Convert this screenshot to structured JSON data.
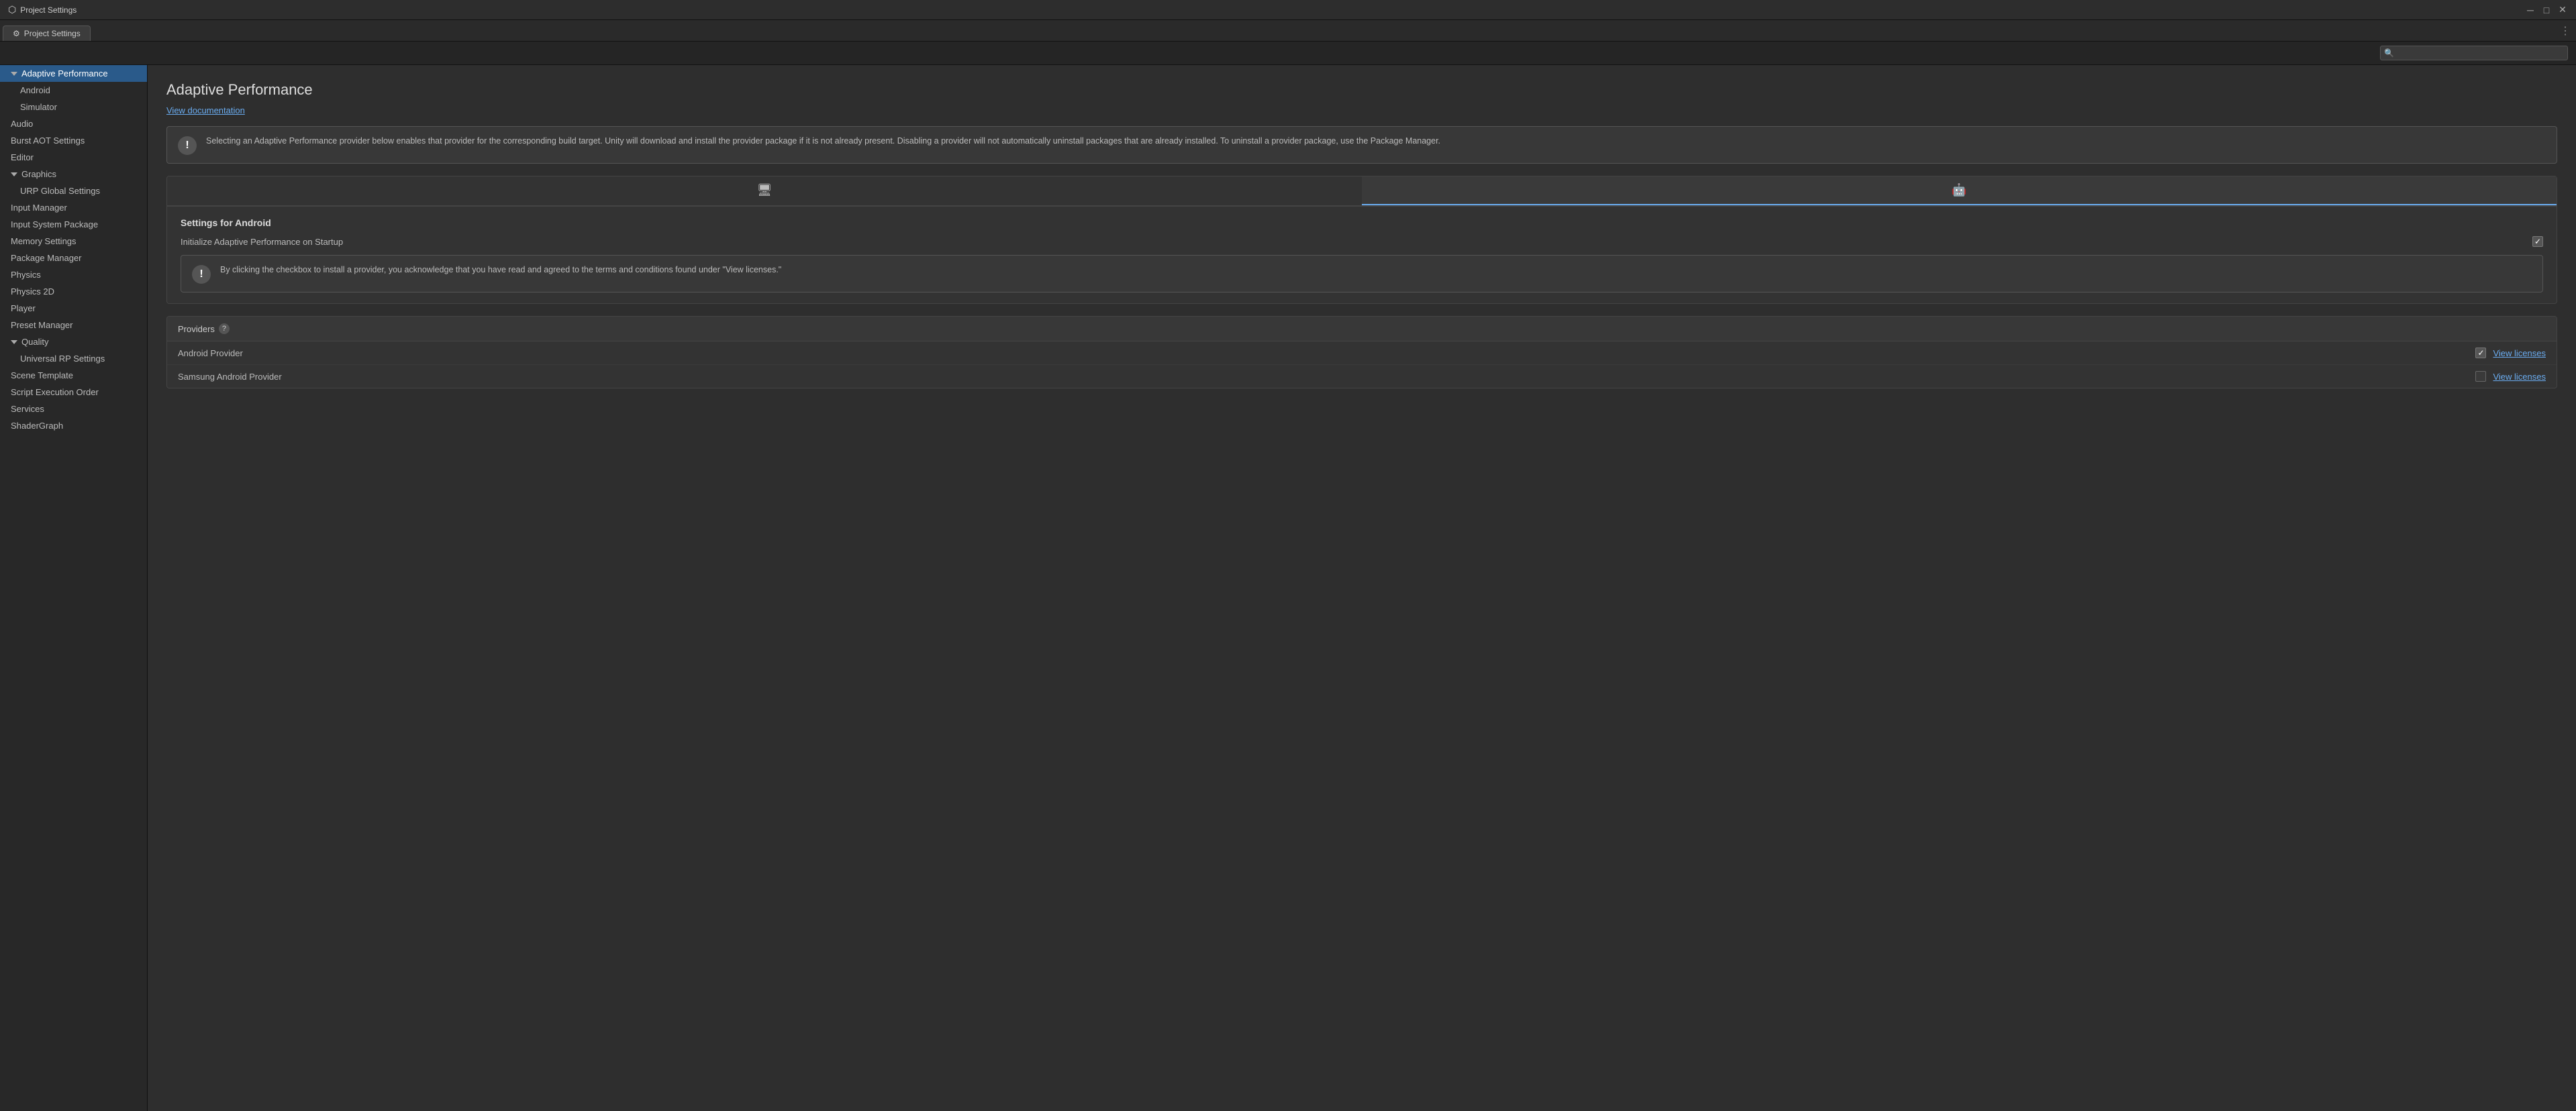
{
  "window": {
    "title": "Project Settings",
    "tab_label": "Project Settings",
    "controls": {
      "minimize": "─",
      "maximize": "□",
      "close": "✕"
    }
  },
  "search": {
    "placeholder": ""
  },
  "sidebar": {
    "items": [
      {
        "id": "adaptive-performance",
        "label": "Adaptive Performance",
        "level": 0,
        "active": true,
        "has_triangle": true
      },
      {
        "id": "android",
        "label": "Android",
        "level": 1
      },
      {
        "id": "simulator",
        "label": "Simulator",
        "level": 1
      },
      {
        "id": "audio",
        "label": "Audio",
        "level": 0
      },
      {
        "id": "burst-aot",
        "label": "Burst AOT Settings",
        "level": 0
      },
      {
        "id": "editor",
        "label": "Editor",
        "level": 0
      },
      {
        "id": "graphics",
        "label": "Graphics",
        "level": 0,
        "has_triangle": true
      },
      {
        "id": "urp-global",
        "label": "URP Global Settings",
        "level": 1
      },
      {
        "id": "input-manager",
        "label": "Input Manager",
        "level": 0
      },
      {
        "id": "input-system",
        "label": "Input System Package",
        "level": 0
      },
      {
        "id": "memory-settings",
        "label": "Memory Settings",
        "level": 0
      },
      {
        "id": "package-manager",
        "label": "Package Manager",
        "level": 0
      },
      {
        "id": "physics",
        "label": "Physics",
        "level": 0
      },
      {
        "id": "physics-2d",
        "label": "Physics 2D",
        "level": 0
      },
      {
        "id": "player",
        "label": "Player",
        "level": 0
      },
      {
        "id": "preset-manager",
        "label": "Preset Manager",
        "level": 0
      },
      {
        "id": "quality",
        "label": "Quality",
        "level": 0,
        "has_triangle": true
      },
      {
        "id": "universal-rp",
        "label": "Universal RP Settings",
        "level": 1
      },
      {
        "id": "scene-template",
        "label": "Scene Template",
        "level": 0
      },
      {
        "id": "script-execution",
        "label": "Script Execution Order",
        "level": 0
      },
      {
        "id": "services",
        "label": "Services",
        "level": 0
      },
      {
        "id": "shader-graph",
        "label": "ShaderGraph",
        "level": 0
      }
    ]
  },
  "content": {
    "title": "Adaptive Performance",
    "view_docs_label": "View documentation",
    "info_box": {
      "text": "Selecting an Adaptive Performance provider below enables that provider for the corresponding build target. Unity will download and install the provider package if it is not already present. Disabling a provider will not automatically uninstall packages that are already installed. To uninstall a provider package, use the Package Manager."
    },
    "platform_tabs": [
      {
        "id": "desktop",
        "icon": "🖥",
        "active": false
      },
      {
        "id": "android",
        "icon": "📱",
        "active": true
      }
    ],
    "settings_for_android": {
      "title": "Settings for Android",
      "initialize_label": "Initialize Adaptive Performance on Startup",
      "initialize_checked": true
    },
    "checkbox_info": {
      "text": "By clicking the checkbox to install a provider, you acknowledge that you have read and agreed to the terms and conditions found under \"View licenses.\""
    },
    "providers": {
      "header": "Providers",
      "items": [
        {
          "name": "Android Provider",
          "checked": true,
          "view_licenses_label": "View licenses"
        },
        {
          "name": "Samsung Android Provider",
          "checked": false,
          "view_licenses_label": "View licenses"
        }
      ]
    }
  },
  "icons": {
    "settings_gear": "⚙",
    "unity_logo": "●",
    "search": "🔍",
    "monitor": "🖥",
    "android": "🤖",
    "exclamation": "!",
    "help": "?"
  }
}
